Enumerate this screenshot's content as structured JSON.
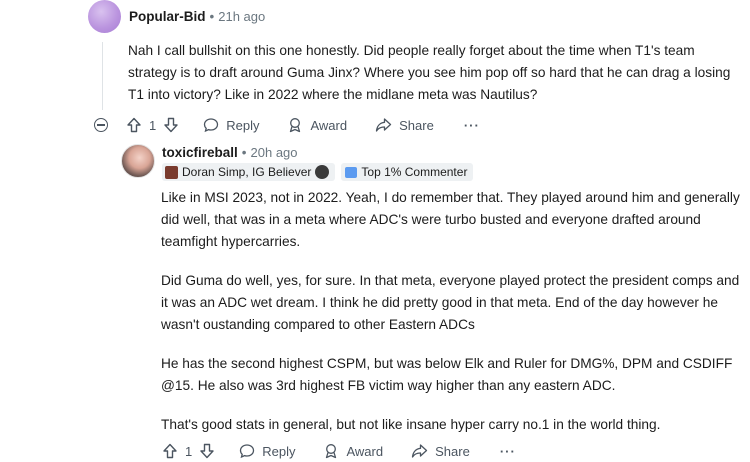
{
  "comment1": {
    "username": "Popular-Bid",
    "separator": "•",
    "time": "21h ago",
    "text": "Nah I call bullshit on this one honestly. Did people really forget about the time when T1's team strategy is to draft around Guma Jinx? Where you see him pop off so hard that he can drag a losing T1 into victory? Like in 2022 where the midlane meta was Nautilus?",
    "actions": {
      "upvote_count": "1",
      "reply": "Reply",
      "award": "Award",
      "share": "Share",
      "more": "···"
    }
  },
  "comment2": {
    "username": "toxicfireball",
    "separator": "•",
    "time": "20h ago",
    "flair": "Doran Simp, IG Believer",
    "top_commenter": "Top 1% Commenter",
    "paragraphs": [
      "Like in MSI 2023, not in 2022. Yeah, I do remember that. They played around him and generally did well, that was in a meta where ADC's were turbo busted and everyone drafted around teamfight hypercarries.",
      "Did Guma do well, yes, for sure. In that meta, everyone played protect the president comps and it was an ADC wet dream. I think he did pretty good in that meta. End of the day however he wasn't oustanding compared to other Eastern ADCs",
      "He has the second highest CSPM, but was below Elk and Ruler for DMG%, DPM and CSDIFF @15. He also was 3rd highest FB victim way higher than any eastern ADC.",
      "That's good stats in general, but not like insane hyper carry no.1 in the world thing."
    ],
    "actions": {
      "upvote_count": "1",
      "reply": "Reply",
      "award": "Award",
      "share": "Share",
      "more": "···"
    }
  },
  "colors": {
    "text": "#1c1c1c",
    "meta": "#6b7780",
    "action": "#4b5560",
    "badge_bg": "#eef1f3",
    "top_commenter_icon": "#5c9bf0"
  }
}
